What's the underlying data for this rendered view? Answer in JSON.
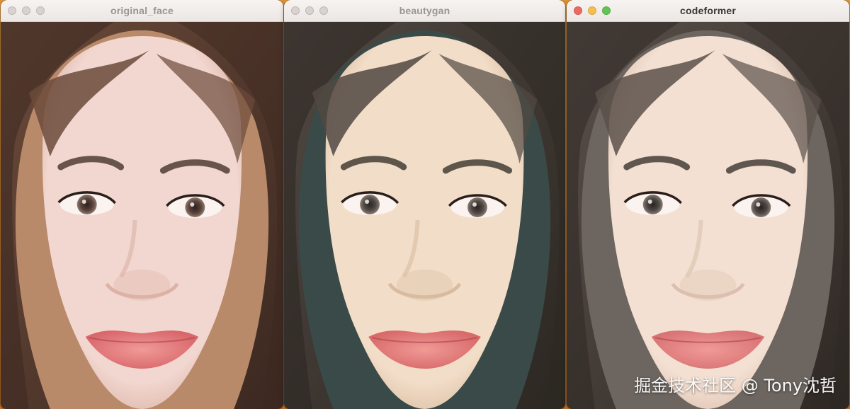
{
  "windows": [
    {
      "title": "original_face",
      "active": false,
      "tone": {
        "skin": "#f1d7cf",
        "skin_shade": "#dcb2a7",
        "hair": "#6b4a3a",
        "hair_dark": "#3b2820",
        "bg": "#b88a6a",
        "lips": "#d9676b",
        "eyes": "#5a4138"
      }
    },
    {
      "title": "beautygan",
      "active": false,
      "tone": {
        "skin": "#f2ddc8",
        "skin_shade": "#d9bca0",
        "hair": "#514842",
        "hair_dark": "#2c2722",
        "bg": "#3a4a48",
        "lips": "#d86a6a",
        "eyes": "#4f4a45"
      }
    },
    {
      "title": "codeformer",
      "active": true,
      "tone": {
        "skin": "#f3e0d2",
        "skin_shade": "#dcbfae",
        "hair": "#5a504a",
        "hair_dark": "#2e2824",
        "bg": "#6d6660",
        "lips": "#d97475",
        "eyes": "#4a4744"
      }
    }
  ],
  "watermark": "掘金技术社区 @ Tony沈哲"
}
